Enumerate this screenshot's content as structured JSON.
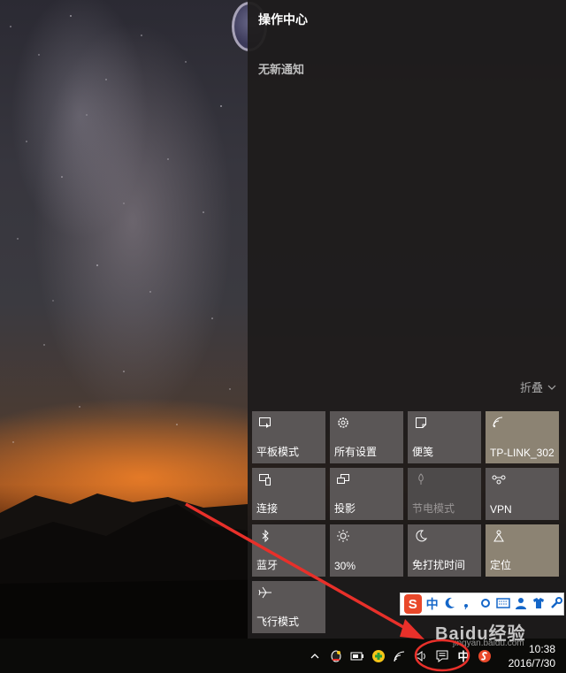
{
  "action_center": {
    "title": "操作中心",
    "empty_message": "无新通知",
    "collapse_label": "折叠"
  },
  "quick_actions": [
    {
      "label": "平板模式",
      "icon": "tablet-mode-icon",
      "state": "off"
    },
    {
      "label": "所有设置",
      "icon": "gear-icon",
      "state": "off"
    },
    {
      "label": "便笺",
      "icon": "note-icon",
      "state": "off"
    },
    {
      "label": "TP-LINK_302",
      "icon": "wifi-icon",
      "state": "on"
    },
    {
      "label": "连接",
      "icon": "connect-icon",
      "state": "off"
    },
    {
      "label": "投影",
      "icon": "project-icon",
      "state": "off"
    },
    {
      "label": "节电模式",
      "icon": "battery-saver-icon",
      "state": "disabled"
    },
    {
      "label": "VPN",
      "icon": "vpn-icon",
      "state": "off"
    },
    {
      "label": "蓝牙",
      "icon": "bluetooth-icon",
      "state": "off"
    },
    {
      "label": "30%",
      "icon": "brightness-icon",
      "state": "off"
    },
    {
      "label": "免打扰时间",
      "icon": "moon-icon",
      "state": "off"
    },
    {
      "label": "定位",
      "icon": "location-icon",
      "state": "on"
    },
    {
      "label": "飞行模式",
      "icon": "airplane-icon",
      "state": "off"
    }
  ],
  "ime_bar": {
    "logo": "S",
    "mode": "中"
  },
  "taskbar": {
    "tray_language": "中",
    "time": "10:38",
    "date": "2016/7/30"
  },
  "watermark": {
    "text": "Baidu经验",
    "url": "jingyan.baidu.com"
  },
  "colors": {
    "tile": "#5a5656",
    "tile_active": "#8c8373",
    "annotation": "#e8302a"
  }
}
